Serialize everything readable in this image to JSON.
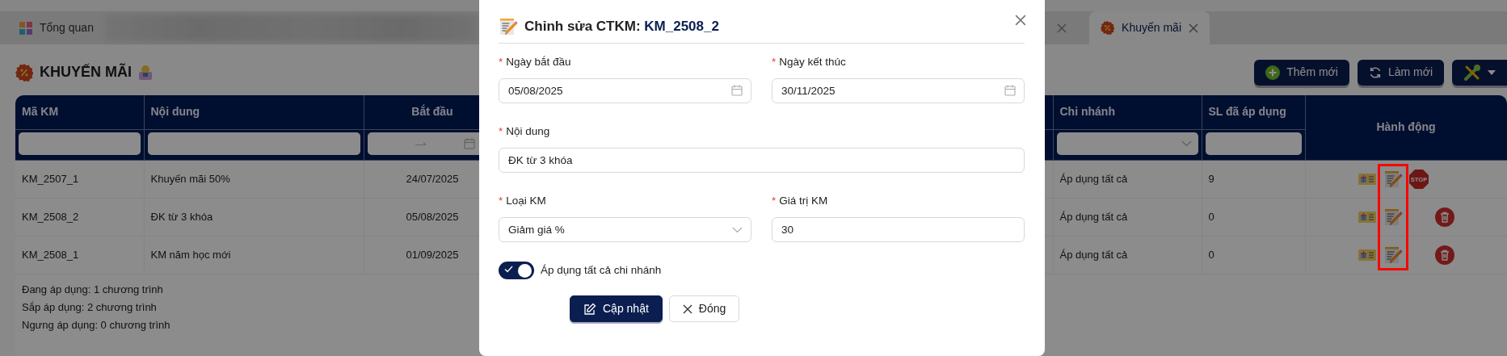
{
  "tabs": [
    {
      "kind": "overview",
      "label": "Tổng quan",
      "selected": false,
      "closable": false
    },
    {
      "kind": "blurred",
      "selected": false
    },
    {
      "kind": "covered",
      "selected": false,
      "closable": true
    },
    {
      "kind": "promo",
      "label": "Khuyến mãi",
      "selected": true,
      "closable": true
    }
  ],
  "page": {
    "title": "KHUYẾN MÃI",
    "toolbar": [
      {
        "kind": "add",
        "label": "Thêm mới"
      },
      {
        "kind": "refresh",
        "label": "Làm mới"
      },
      {
        "kind": "tools"
      }
    ]
  },
  "table": {
    "columns": [
      {
        "label": "Mã KM",
        "kind": "text"
      },
      {
        "label": "Nội dung",
        "kind": "text"
      },
      {
        "label": "Bắt đầu",
        "kind": "date"
      },
      {
        "label": "Chi nhánh",
        "kind": "select"
      },
      {
        "label": "SL đã áp dụng",
        "kind": "text"
      },
      {
        "label": "Hành động",
        "kind": "actions"
      }
    ],
    "rows": [
      {
        "cells": [
          "KM_2507_1",
          "Khuyến mãi 50%",
          "24/07/2025",
          "Áp dụng tất cả",
          "9"
        ],
        "can_stop": true,
        "can_delete": false,
        "stop_label": "STOP"
      },
      {
        "cells": [
          "KM_2508_2",
          "ĐK từ 3 khóa",
          "05/08/2025",
          "Áp dụng tất cả",
          "0"
        ],
        "can_stop": false,
        "can_delete": true
      },
      {
        "cells": [
          "KM_2508_1",
          "KM năm học mới",
          "01/09/2025",
          "Áp dụng tất cả",
          "0"
        ],
        "can_stop": false,
        "can_delete": true
      }
    ],
    "highlight": {
      "kind": "red_box"
    }
  },
  "summary": [
    "Đang áp dụng: 1 chương trình",
    "Sắp áp dụng: 2 chương trình",
    "Ngưng áp dụng: 0 chương trình"
  ],
  "modal": {
    "title": "Chỉnh sửa CTKM:",
    "code": "KM_2508_2",
    "fields": [
      {
        "kind": "date",
        "marker": "*",
        "label": "Ngày bắt đầu",
        "value": "05/08/2025"
      },
      {
        "kind": "date",
        "marker": "*",
        "label": "Ngày kết thúc",
        "value": "30/11/2025"
      },
      {
        "kind": "wide_text",
        "marker": "*",
        "label": "Nội dung",
        "value": "ĐK từ 3 khóa"
      },
      {
        "kind": "select",
        "marker": "*",
        "label": "Loại KM",
        "value": "Giảm giá %"
      },
      {
        "kind": "text",
        "marker": "*",
        "label": "Giá trị KM",
        "value": "30"
      }
    ],
    "toggle": {
      "label": "Áp dụng tất cả chi nhánh",
      "on": true
    },
    "buttons": [
      {
        "kind": "primary",
        "label": "Cập nhật"
      },
      {
        "kind": "close",
        "label": "Đóng"
      }
    ]
  }
}
